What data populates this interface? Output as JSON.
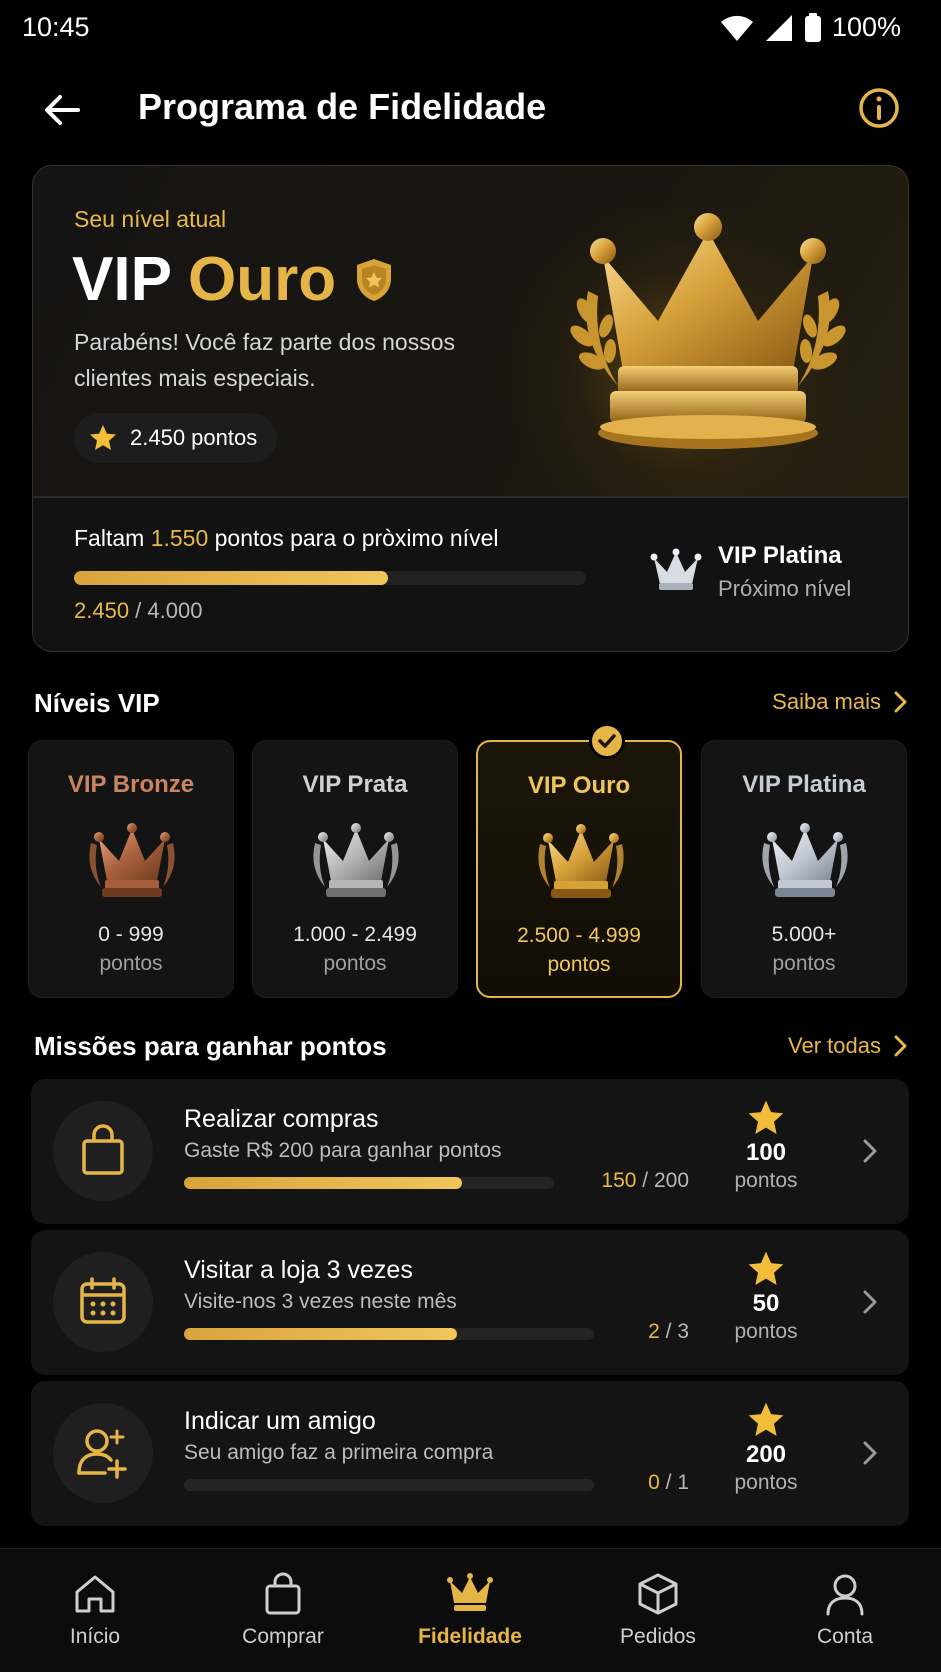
{
  "status_bar": {
    "time": "10:45",
    "battery": "100%"
  },
  "header": {
    "title": "Programa de Fidelidade"
  },
  "hero": {
    "subtitle": "Seu nível atual",
    "level_prefix": "VIP",
    "level_name": "Ouro",
    "description": "Parabéns! Você faz parte dos nossos clientes mais especiais.",
    "points_label": "2.450 pontos",
    "progress_prefix": "Faltam",
    "progress_missing": "1.550",
    "progress_suffix": "pontos para o pròximo nível",
    "progress_current": "2.450",
    "progress_sep": " / ",
    "progress_target": "4.000",
    "progress_fraction": 0.6125,
    "next_level_name": "VIP Platina",
    "next_level_label": "Próximo nível"
  },
  "levels_section": {
    "title": "Níveis VIP",
    "link": "Saiba mais"
  },
  "levels": [
    {
      "name": "VIP Bronze",
      "range": "0 - 999",
      "unit": "pontos",
      "color": "#c98560",
      "crown": "bronze-crown-icon"
    },
    {
      "name": "VIP Prata",
      "range": "1.000 - 2.499",
      "unit": "pontos",
      "color": "#d0d0d0",
      "crown": "silver-crown-icon"
    },
    {
      "name": "VIP Ouro",
      "range": "2.500 - 4.999",
      "unit": "pontos",
      "color": "#f0c65a",
      "crown": "gold-crown-icon",
      "current": true
    },
    {
      "name": "VIP Platina",
      "range": "5.000+",
      "unit": "pontos",
      "color": "#c5ccd6",
      "crown": "platinum-crown-icon"
    }
  ],
  "missions_section": {
    "title": "Missões para ganhar pontos",
    "link": "Ver todas"
  },
  "missions": [
    {
      "title": "Realizar compras",
      "desc": "Gaste R$ 200 para ganhar pontos",
      "done": "150",
      "total": " / 200",
      "fraction": 0.75,
      "points": "100",
      "unit": "pontos",
      "icon": "shopping-bag-icon"
    },
    {
      "title": "Visitar a loja 3 vezes",
      "desc": "Visite-nos 3 vezes neste mês",
      "done": "2",
      "total": " / 3",
      "fraction": 0.6667,
      "points": "50",
      "unit": "pontos",
      "icon": "calendar-icon"
    },
    {
      "title": "Indicar um amigo",
      "desc": "Seu amigo faz a primeira compra",
      "done": "0",
      "total": " / 1",
      "fraction": 0,
      "points": "200",
      "unit": "pontos",
      "icon": "add-user-icon"
    }
  ],
  "nav": [
    {
      "label": "Início",
      "icon": "home-icon"
    },
    {
      "label": "Comprar",
      "icon": "shopping-bag-icon"
    },
    {
      "label": "Fidelidade",
      "icon": "crown-icon",
      "active": true
    },
    {
      "label": "Pedidos",
      "icon": "box-icon"
    },
    {
      "label": "Conta",
      "icon": "user-icon"
    }
  ],
  "colors": {
    "accent": "#e6b548",
    "background": "#000000",
    "card": "#141414"
  }
}
